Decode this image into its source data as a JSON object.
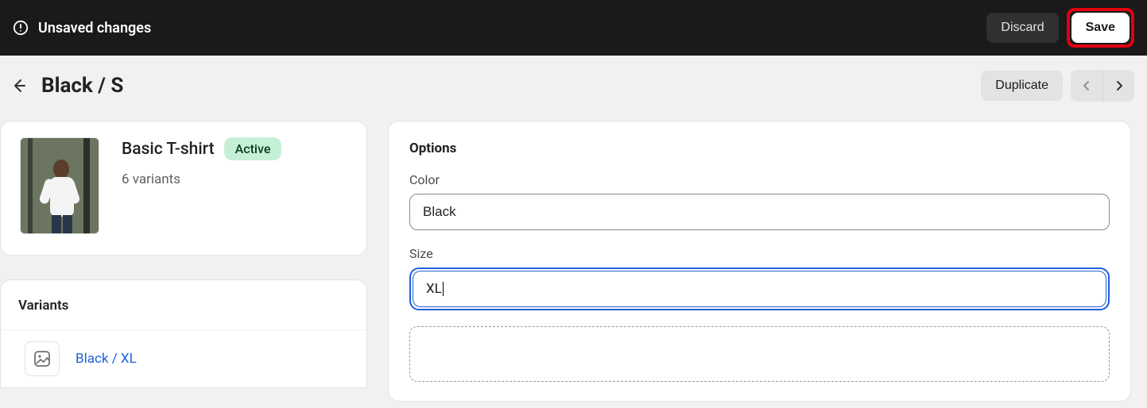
{
  "topbar": {
    "message": "Unsaved changes",
    "discard_label": "Discard",
    "save_label": "Save"
  },
  "page": {
    "title": "Black / S",
    "duplicate_label": "Duplicate"
  },
  "product": {
    "name": "Basic T-shirt",
    "status_label": "Active",
    "variant_count_label": "6 variants"
  },
  "variants_panel": {
    "title": "Variants",
    "items": [
      {
        "label": "Black / XL"
      }
    ]
  },
  "options": {
    "title": "Options",
    "color_label": "Color",
    "color_value": "Black",
    "size_label": "Size",
    "size_value": "XL"
  }
}
